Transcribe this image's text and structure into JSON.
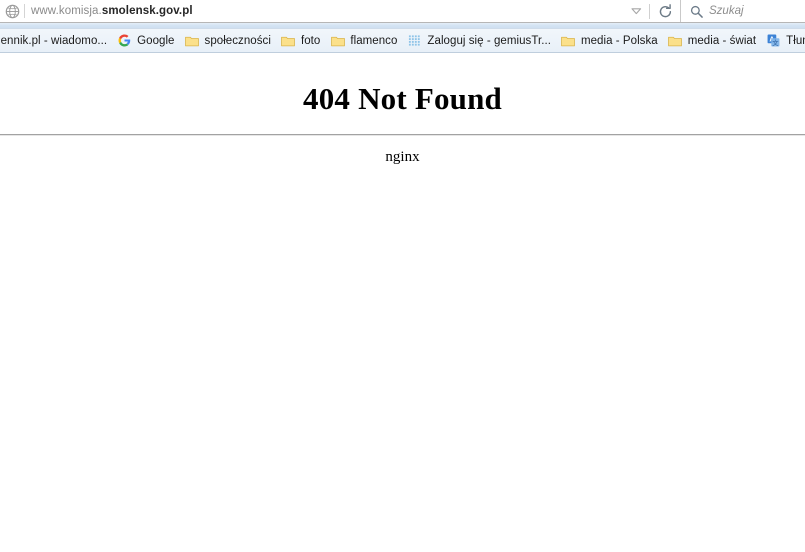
{
  "browser": {
    "urlbar": {
      "icon": "globe-icon",
      "url_prefix": "www.komisja.",
      "url_domain": "smolensk.gov.pl",
      "full_url": "www.komisja.smolensk.gov.pl",
      "dropdown_icon": "chevron-down-icon",
      "reload_icon": "reload-icon"
    },
    "search": {
      "icon": "search-icon",
      "placeholder": "Szukaj",
      "value": ""
    },
    "bookmarks": [
      {
        "label": "iennik.pl - wiadomo...",
        "icon": "none",
        "clipped": true
      },
      {
        "label": "Google",
        "icon": "google-g-icon",
        "clipped": false
      },
      {
        "label": "społeczności",
        "icon": "folder-icon",
        "clipped": false
      },
      {
        "label": "foto",
        "icon": "folder-icon",
        "clipped": false
      },
      {
        "label": "flamenco",
        "icon": "folder-icon",
        "clipped": false
      },
      {
        "label": "Zaloguj się - gemiusTr...",
        "icon": "gemius-grid-icon",
        "clipped": false
      },
      {
        "label": "media - Polska",
        "icon": "folder-icon",
        "clipped": false
      },
      {
        "label": "media - świat",
        "icon": "folder-icon",
        "clipped": false
      },
      {
        "label": "Tłumacz",
        "icon": "google-translate-icon",
        "clipped": false
      }
    ]
  },
  "page": {
    "title": "404 Not Found",
    "server_signature": "nginx"
  },
  "colors": {
    "folder_icon": "#fbe08a",
    "folder_icon_border": "#d9b44a",
    "chrome_band": "#d3e3f3",
    "bookmarks_bar": "#eef4fa",
    "divider": "#a2a2a2",
    "url_domain_text": "#262626",
    "url_prefix_text": "#8a8a8a",
    "search_placeholder_text": "#8d8d8d"
  }
}
